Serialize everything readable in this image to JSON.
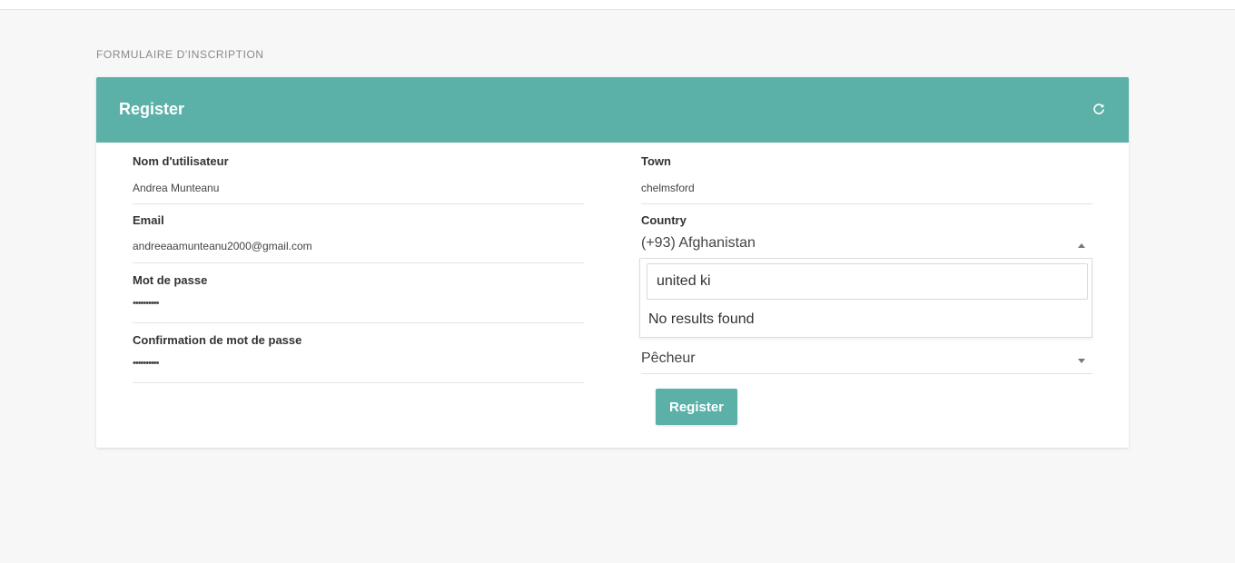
{
  "page": {
    "section_title": "FORMULAIRE D'INSCRIPTION"
  },
  "card": {
    "title": "Register",
    "refresh_icon": "refresh-icon"
  },
  "left_fields": [
    {
      "label": "Nom d'utilisateur",
      "value": "Andrea Munteanu"
    },
    {
      "label": "Email",
      "value": "andreeaamunteanu2000@gmail.com"
    },
    {
      "label": "Mot de passe",
      "value": "••••••••••"
    },
    {
      "label": "Confirmation de mot de passe",
      "value": "••••••••••"
    }
  ],
  "town": {
    "label": "Town",
    "value": "chelmsford"
  },
  "country": {
    "label": "Country",
    "selected": "(+93) Afghanistan",
    "search_value": "united ki",
    "no_results": "No results found"
  },
  "functions": {
    "selected": "Pêcheur"
  },
  "register_button": "Register",
  "colors": {
    "accent": "#5bb0a8",
    "background": "#f7f7f7"
  }
}
